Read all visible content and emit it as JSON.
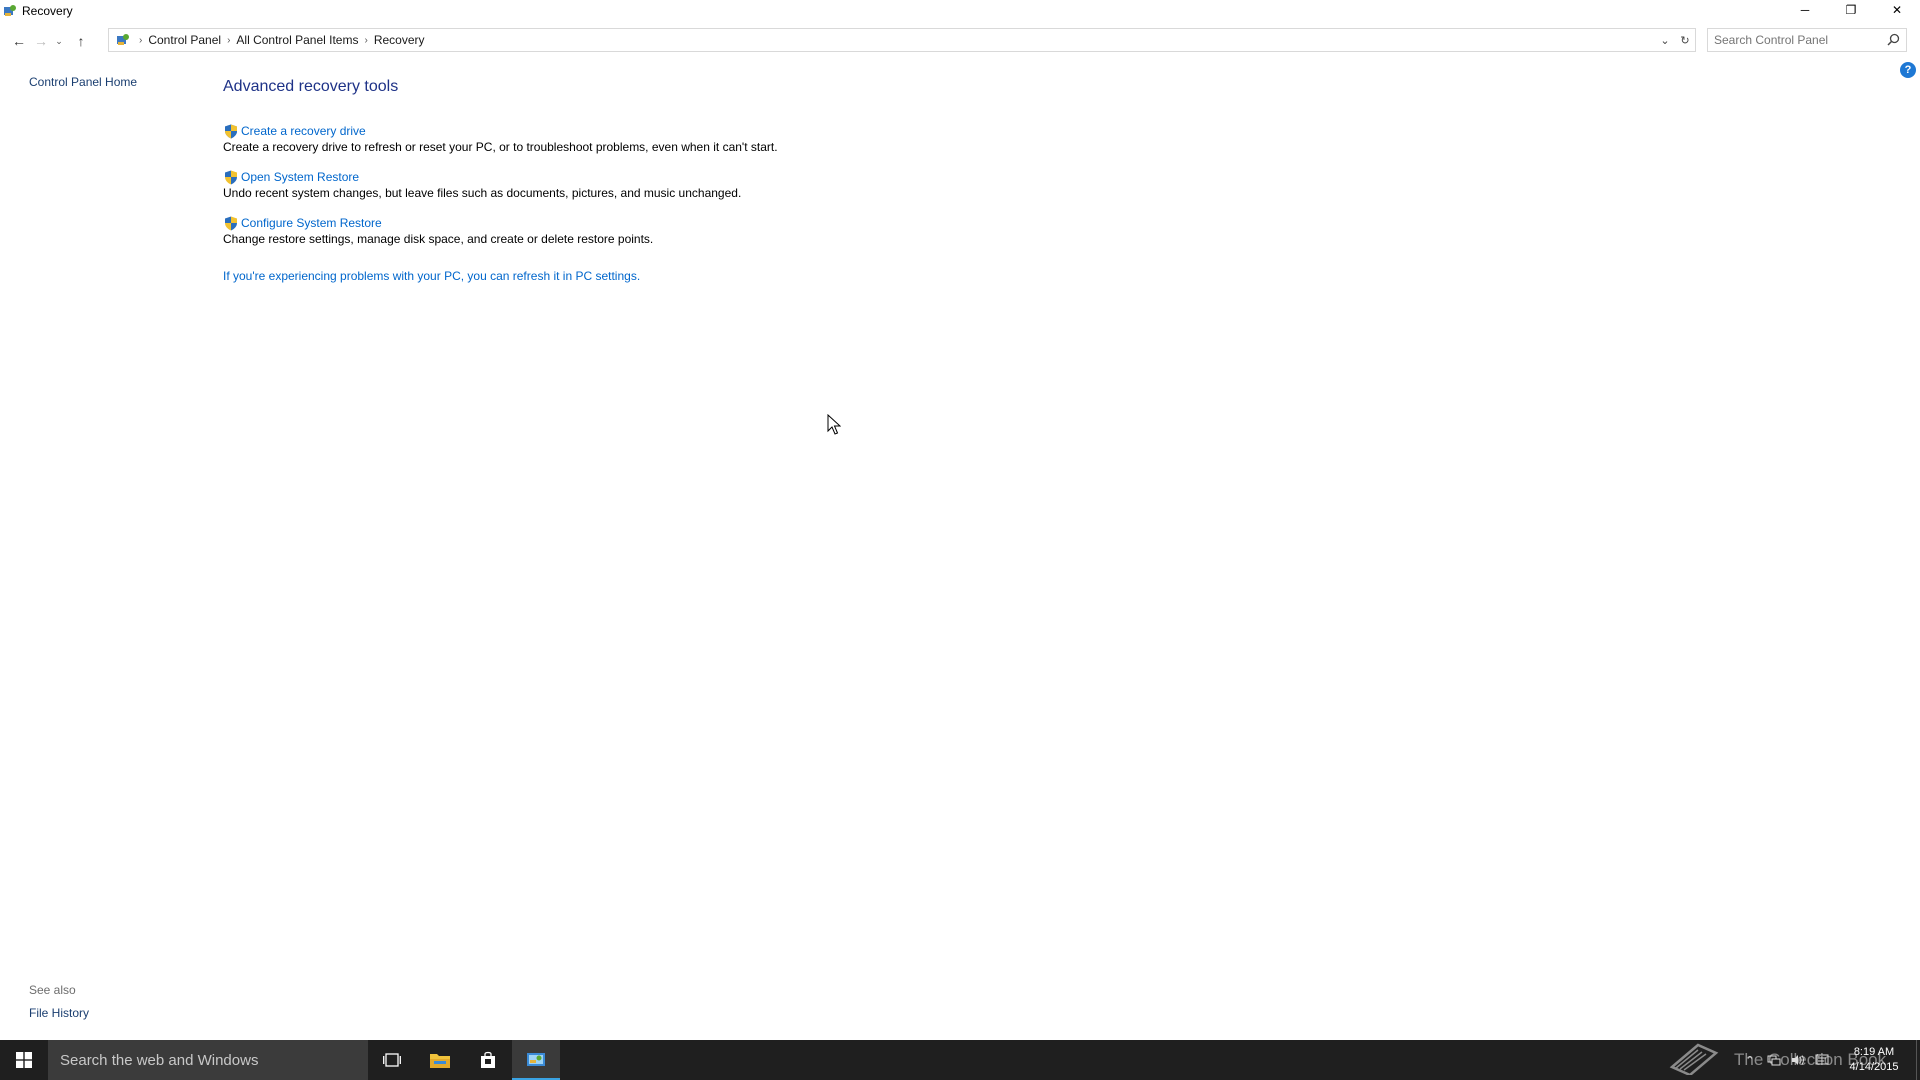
{
  "window": {
    "title": "Recovery",
    "controls": {
      "minimize": "─",
      "restore": "❐",
      "close": "✕"
    }
  },
  "nav": {
    "back": "←",
    "forward": "→",
    "recent": "⌄",
    "up": "↑"
  },
  "breadcrumb": {
    "items": [
      "Control Panel",
      "All Control Panel Items",
      "Recovery"
    ]
  },
  "search": {
    "placeholder": "Search Control Panel"
  },
  "left_pane": {
    "home_link": "Control Panel Home",
    "see_also_label": "See also",
    "file_history_link": "File History"
  },
  "main": {
    "heading": "Advanced recovery tools",
    "tools": [
      {
        "link": "Create a recovery drive",
        "description": "Create a recovery drive to refresh or reset your PC, or to troubleshoot problems, even when it can't start."
      },
      {
        "link": "Open System Restore",
        "description": "Undo recent system changes, but leave files such as documents, pictures, and music unchanged."
      },
      {
        "link": "Configure System Restore",
        "description": "Change restore settings, manage disk space, and create or delete restore points."
      }
    ],
    "refresh_link": "If you're experiencing problems with your PC, you can refresh it in PC settings."
  },
  "help": {
    "label": "?"
  },
  "taskbar": {
    "search_placeholder": "Search the web and Windows",
    "watermark": "The Collection Book",
    "clock_time": "8:19 AM",
    "clock_date": "4/14/2015"
  },
  "colors": {
    "link": "#0066cc",
    "heading": "#1e3287",
    "taskbar": "#1f1f1f",
    "taskbar_search": "#3b3b3b",
    "active_indicator": "#3aa3e3"
  }
}
